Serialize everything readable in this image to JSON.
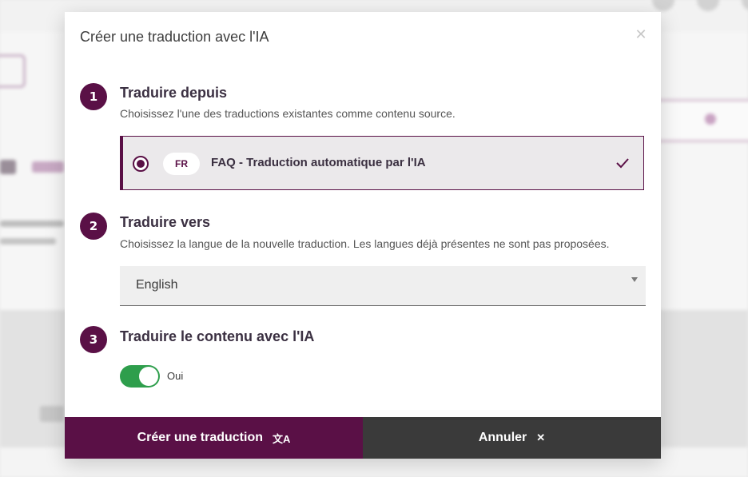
{
  "modal": {
    "title": "Créer une traduction avec l'IA",
    "close_icon": "close-icon",
    "steps": [
      {
        "number": "1",
        "title": "Traduire depuis",
        "description": "Choisissez l'une des traductions existantes comme contenu source."
      },
      {
        "number": "2",
        "title": "Traduire vers",
        "description": "Choisissez la langue de la nouvelle traduction. Les langues déjà présentes ne sont pas proposées."
      },
      {
        "number": "3",
        "title": "Traduire le contenu avec l'IA",
        "description": ""
      }
    ],
    "source_option": {
      "lang_code": "FR",
      "label": "FAQ - Traduction automatique par l'IA",
      "selected": true
    },
    "target_language": {
      "value": "English"
    },
    "ai_toggle": {
      "on": true,
      "label": "Oui"
    },
    "buttons": {
      "create_label": "Créer une traduction",
      "create_icon": "translate-icon",
      "cancel_label": "Annuler",
      "cancel_icon": "close-icon"
    }
  },
  "colors": {
    "accent": "#5a1046",
    "toggle_on": "#2e9e4c",
    "cancel_bg": "#3a3a3a"
  }
}
